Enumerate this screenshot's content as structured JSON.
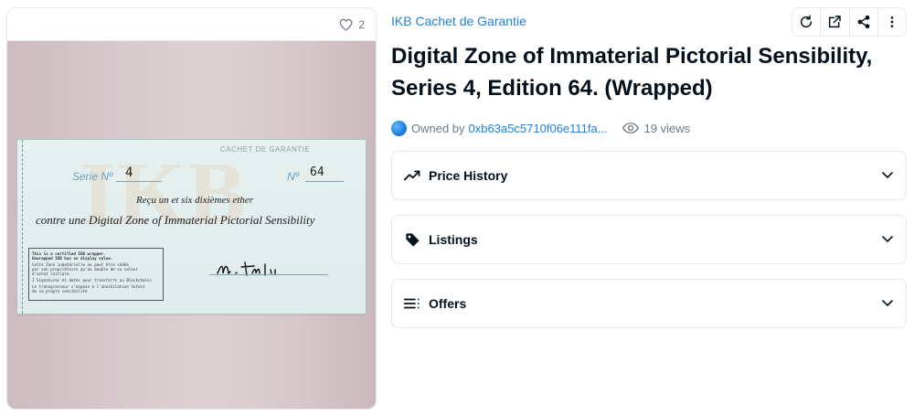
{
  "media": {
    "favorite_count": "2",
    "favorite_icon": "heart-outline-icon",
    "cheque": {
      "header": "CACHET DE GARANTIE",
      "serie_label": "Serie Nº",
      "serie_value": "4",
      "number_label": "Nº",
      "number_value": "64",
      "line1": "Reçu un et six dixièmes ether",
      "line2": "contre une Digital Zone of Immaterial Pictorial Sensibility",
      "fine_print": [
        "This is a certified IKB wrapper.",
        "Unwrapped IKB has no display value.",
        "Cette Zone inmatérielle ne peut être cédée",
        "par son propriétaire qu'au double de sa valeur",
        "d'achat initiale.",
        "I Signatures et dates pour transferts ou Blockchain)",
        "Le transgresseur s'expose à l'annihilation totale",
        "de sa propre sensibilité"
      ]
    }
  },
  "collection": {
    "name": "IKB Cachet de Garantie"
  },
  "toolbar": {
    "buttons": [
      "refresh-icon",
      "external-link-icon",
      "share-icon",
      "more-vertical-icon"
    ]
  },
  "title": "Digital Zone of Immaterial Pictorial Sensibility, Series 4, Edition 64. (Wrapped)",
  "owner": {
    "label": "Owned by",
    "address": "0xb63a5c5710f06e111fa...",
    "views": "19 views"
  },
  "panels": [
    {
      "label": "Price History",
      "icon": "trending-up-icon"
    },
    {
      "label": "Listings",
      "icon": "tag-icon"
    },
    {
      "label": "Offers",
      "icon": "list-icon"
    }
  ],
  "colors": {
    "accent": "#2081e2",
    "text": "#04111d",
    "muted": "#707a83",
    "border": "#e5e8eb"
  }
}
